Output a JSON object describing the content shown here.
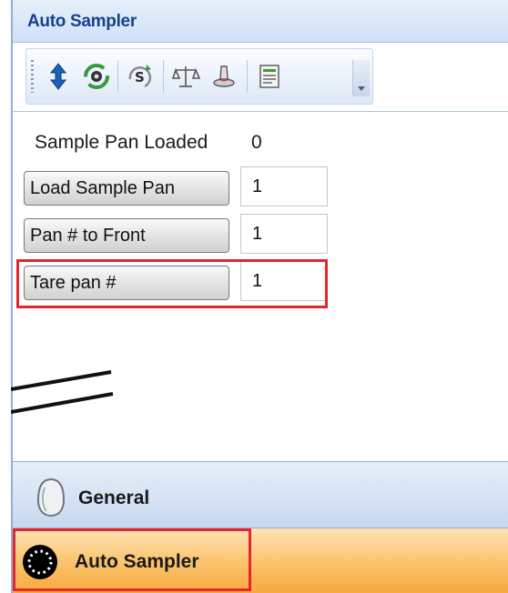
{
  "window": {
    "title": "Auto Sampler"
  },
  "toolbar": {
    "buttons": [
      {
        "icon": "up-down-arrows-icon"
      },
      {
        "icon": "rotate-sampler-icon"
      },
      {
        "icon": "sample-reload-icon"
      },
      {
        "icon": "balance-scale-icon"
      },
      {
        "icon": "sample-pan-icon"
      },
      {
        "icon": "notes-list-icon"
      }
    ]
  },
  "sampler": {
    "loaded_label": "Sample Pan Loaded",
    "loaded_value": "0",
    "load_button": "Load Sample Pan",
    "load_value": "1",
    "front_button": "Pan # to Front",
    "front_value": "1",
    "tare_button": "Tare pan #",
    "tare_value": "1"
  },
  "nav": {
    "general": "General",
    "auto_sampler": "Auto Sampler"
  },
  "colors": {
    "title": "#15428b",
    "highlight": "#e8242b",
    "selected_nav": "#fbc26b"
  }
}
